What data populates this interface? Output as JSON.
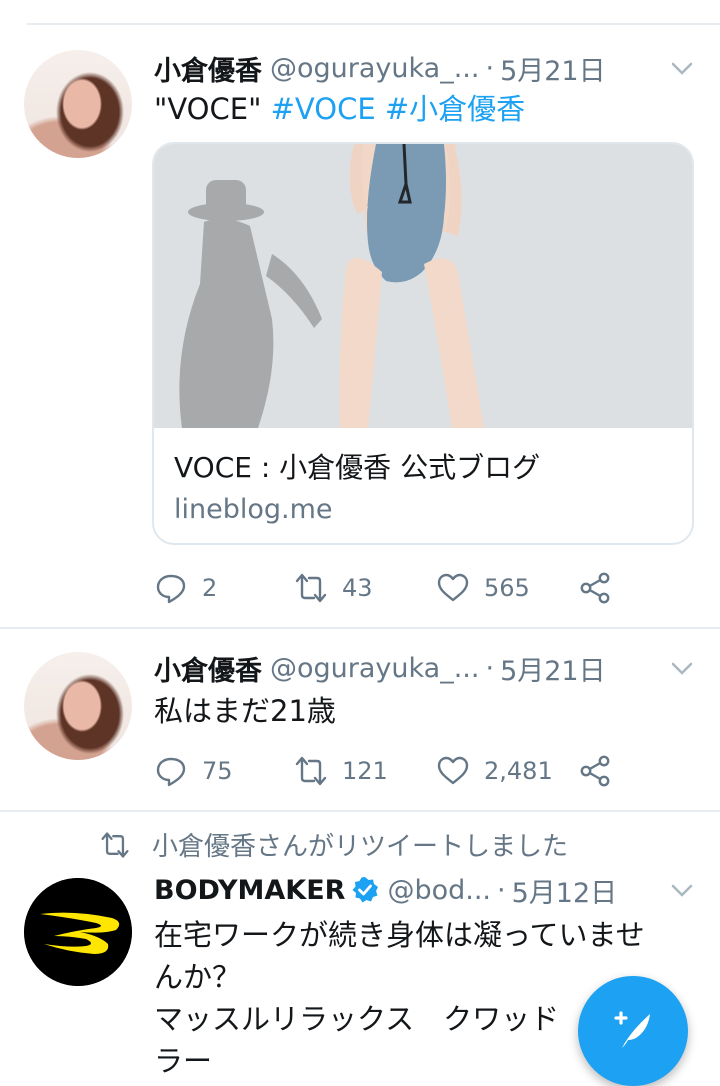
{
  "tweets": [
    {
      "name": "小倉優香",
      "handle": "@ogurayuka_...",
      "separator": "·",
      "date": "5月21日",
      "text": "\"VOCE\"",
      "hashtags": [
        "#VOCE",
        "#小倉優香"
      ],
      "card": {
        "title": "VOCE : 小倉優香 公式ブログ",
        "domain": "lineblog.me"
      },
      "replies": "2",
      "retweets": "43",
      "likes": "565"
    },
    {
      "name": "小倉優香",
      "handle": "@ogurayuka_...",
      "separator": "·",
      "date": "5月21日",
      "text": "私はまだ21歳",
      "replies": "75",
      "retweets": "121",
      "likes": "2,481"
    },
    {
      "retweet_context": "小倉優香さんがリツイートしました",
      "name": "BODYMAKER",
      "handle": "@bod...",
      "separator": "·",
      "date": "5月12日",
      "text_lines": [
        "在宅ワークが続き身体は凝っていませ",
        "んか？",
        "マッスルリラックス　クワッド",
        "ラー"
      ]
    }
  ],
  "colors": {
    "accent": "#1da1f2",
    "secondary_text": "#657786",
    "divider": "#e6ecf0"
  },
  "icons": [
    "reply-icon",
    "retweet-icon",
    "like-icon",
    "share-icon",
    "caret-down-icon",
    "verified-icon",
    "compose-tweet-icon"
  ]
}
